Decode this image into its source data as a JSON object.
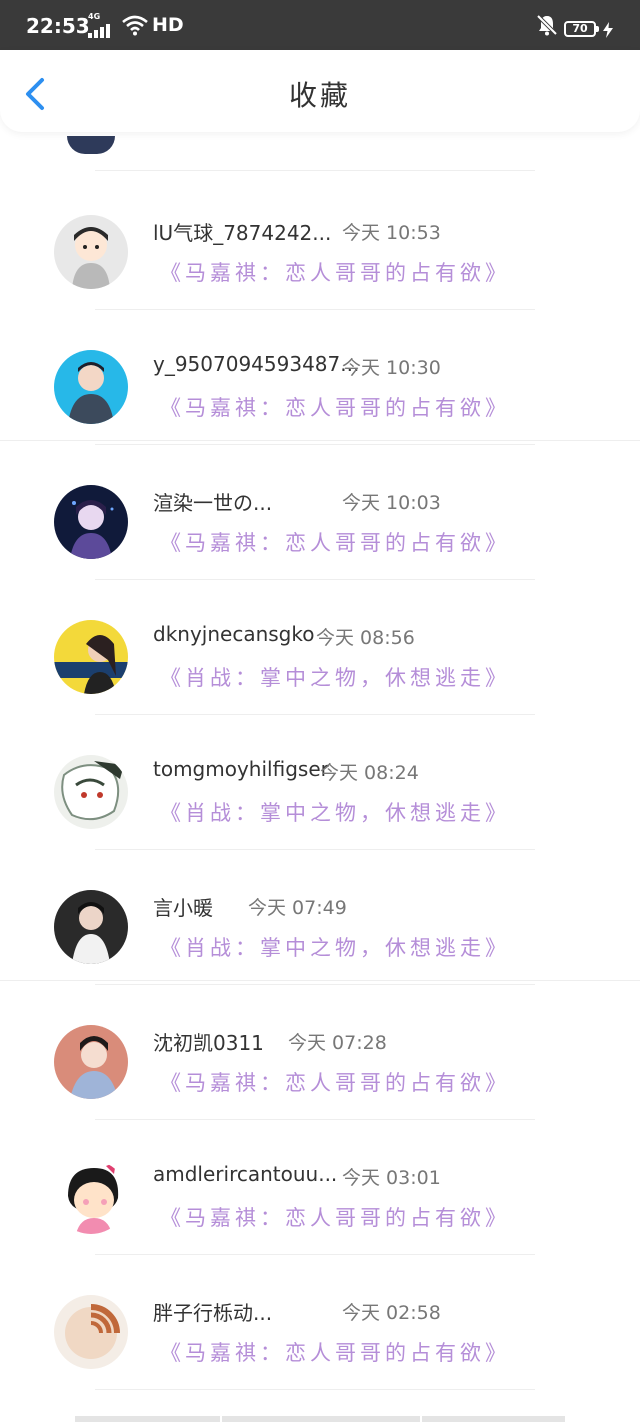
{
  "status_bar": {
    "time": "22:53",
    "network": "4G",
    "hd": "HD",
    "battery": "70",
    "icons": [
      "signal-icon",
      "wifi-icon",
      "mute-icon",
      "battery-icon",
      "charging-icon"
    ]
  },
  "header": {
    "title": "收藏",
    "back_icon": "back-arrow-icon"
  },
  "colors": {
    "accent": "#2d8ff0",
    "novel": "#b58ed8",
    "name": "#333333",
    "time": "#777777"
  },
  "items": [
    {
      "name": "lU气球_7874242...",
      "time": "今天 10:53",
      "novel": "《马嘉祺：恋人哥哥的占有欲》"
    },
    {
      "name": "y_9507094593487...",
      "time": "今天 10:30",
      "novel": "《马嘉祺：恋人哥哥的占有欲》"
    },
    {
      "name": "渲染一世の...",
      "time": "今天 10:03",
      "novel": "《马嘉祺：恋人哥哥的占有欲》"
    },
    {
      "name": "dknyjnecansgko",
      "time": "今天 08:56",
      "novel": "《肖战：掌中之物，休想逃走》"
    },
    {
      "name": "tomgmoyhilfigser",
      "time": "今天 08:24",
      "novel": "《肖战：掌中之物，休想逃走》"
    },
    {
      "name": "言小暖",
      "time": "今天 07:49",
      "novel": "《肖战：掌中之物，休想逃走》"
    },
    {
      "name": "沈初凯0311",
      "time": "今天 07:28",
      "novel": "《马嘉祺：恋人哥哥的占有欲》"
    },
    {
      "name": "amdlerircantouu...",
      "time": "今天 03:01",
      "novel": "《马嘉祺：恋人哥哥的占有欲》"
    },
    {
      "name": "胖子行栎动...",
      "time": "今天 02:58",
      "novel": "《马嘉祺：恋人哥哥的占有欲》"
    }
  ]
}
